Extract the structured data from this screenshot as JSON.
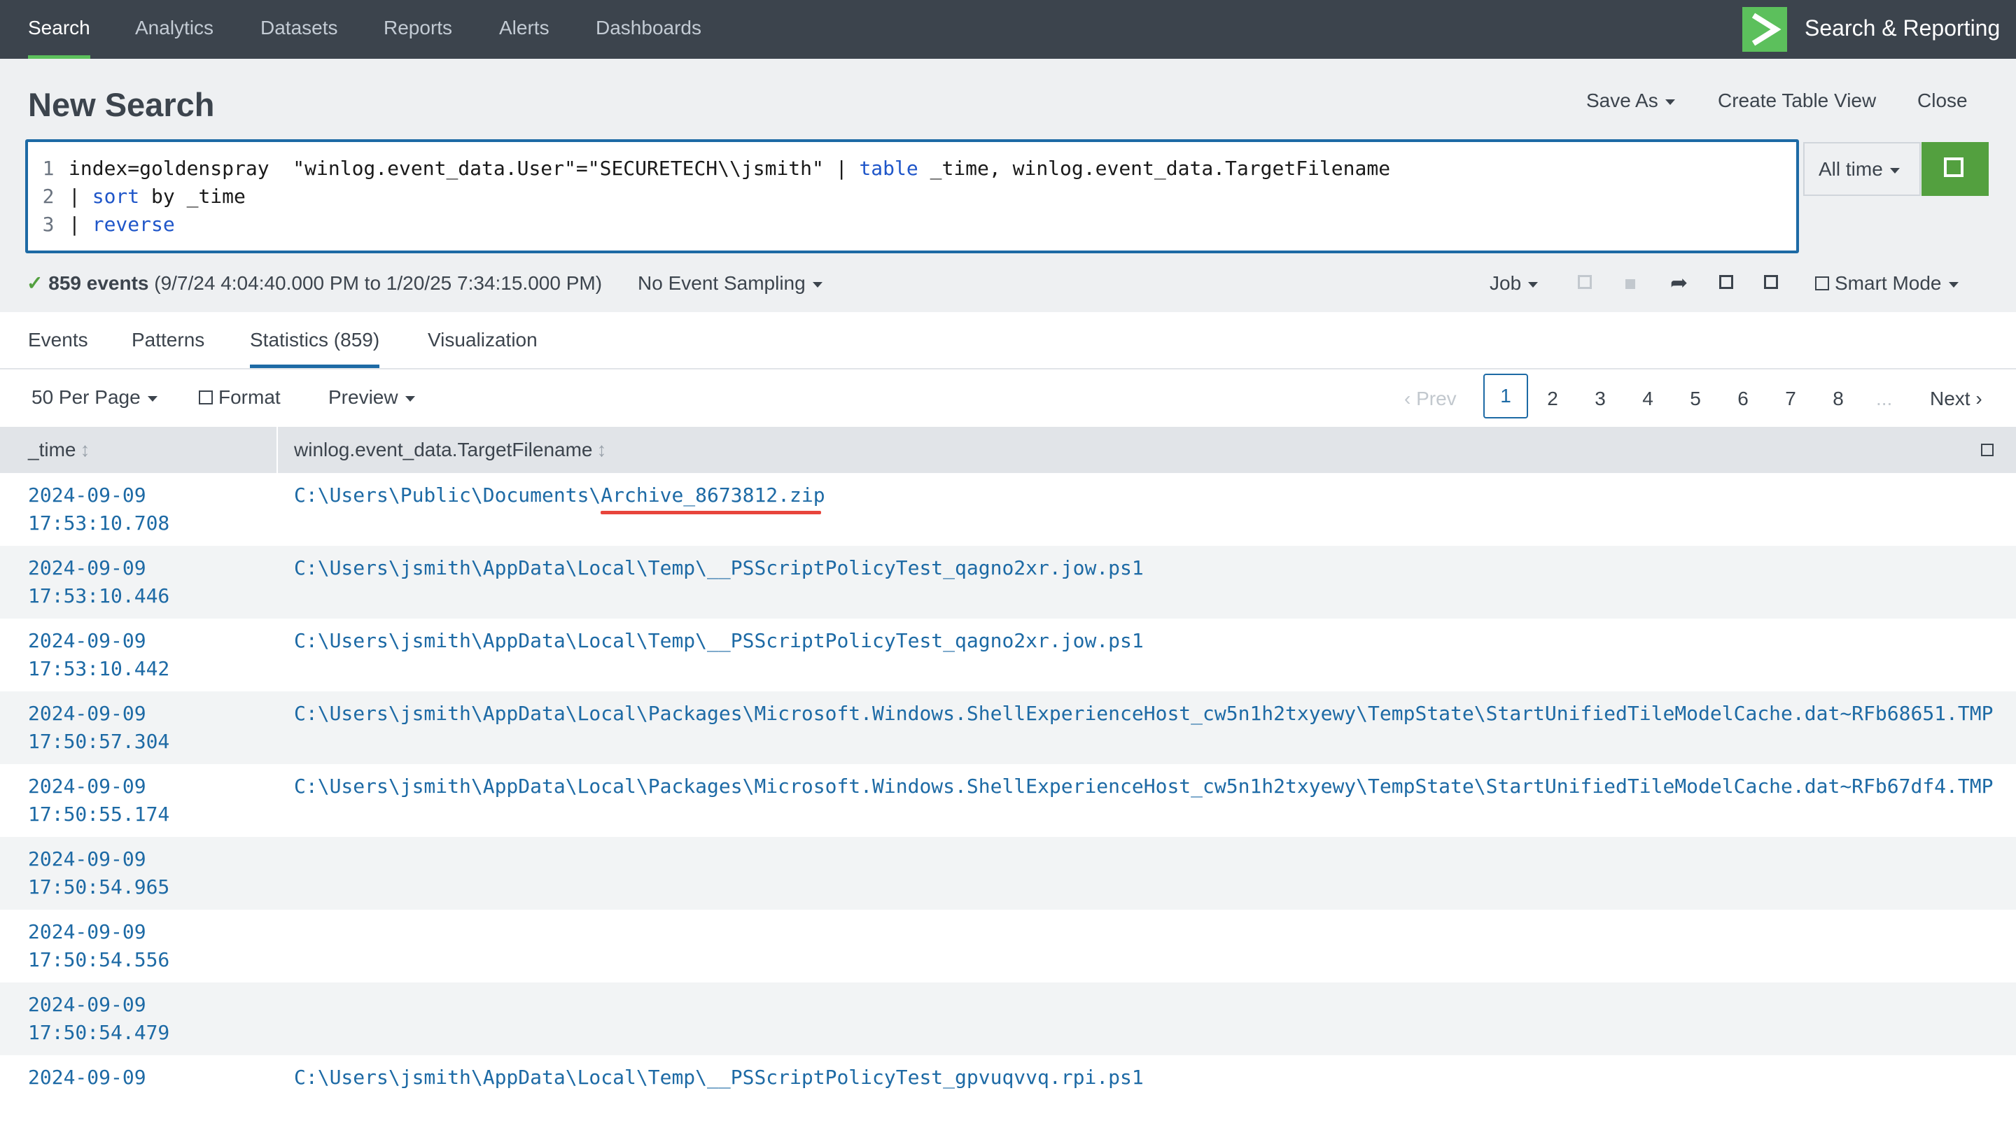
{
  "nav": {
    "items": [
      "Search",
      "Analytics",
      "Datasets",
      "Reports",
      "Alerts",
      "Dashboards"
    ],
    "app_name": "Search & Reporting"
  },
  "header": {
    "title": "New Search",
    "save_as": "Save As",
    "create_table_view": "Create Table View",
    "close": "Close"
  },
  "query": {
    "line_numbers": [
      "1",
      "2",
      "3"
    ],
    "line1_a": "index=goldenspray  \"winlog.event_data.User\"=\"SECURETECH\\\\jsmith\" | ",
    "line1_kw": "table",
    "line1_b": " _time, winlog.event_data.TargetFilename",
    "line2_a": "| ",
    "line2_kw": "sort",
    "line2_b": " by _time",
    "line3_a": "| ",
    "line3_kw": "reverse"
  },
  "time_picker": {
    "label": "All time"
  },
  "status": {
    "events": "859 events",
    "range": " (9/7/24 4:04:40.000 PM to 1/20/25 7:34:15.000 PM)",
    "sampling": "No Event Sampling",
    "job": "Job",
    "mode": "Smart Mode"
  },
  "tabs": [
    "Events",
    "Patterns",
    "Statistics (859)",
    "Visualization"
  ],
  "toolbar": {
    "per_page": "50 Per Page",
    "format": "Format",
    "preview": "Preview"
  },
  "pagination": {
    "prev": "‹ Prev",
    "pages": [
      "1",
      "2",
      "3",
      "4",
      "5",
      "6",
      "7",
      "8"
    ],
    "ellipsis": "...",
    "next": "Next ›"
  },
  "table": {
    "headers": [
      "_time",
      "winlog.event_data.TargetFilename"
    ],
    "rows": [
      {
        "date": "2024-09-09",
        "time": "17:53:10.708",
        "file_prefix": "C:\\Users\\Public\\Documents\\",
        "file_name": "Archive_8673812.zip"
      },
      {
        "date": "2024-09-09",
        "time": "17:53:10.446",
        "file_prefix": "C:\\Users\\jsmith\\AppData\\Local\\Temp\\__PSScriptPolicyTest_qagno2xr.jow.ps1",
        "file_name": ""
      },
      {
        "date": "2024-09-09",
        "time": "17:53:10.442",
        "file_prefix": "C:\\Users\\jsmith\\AppData\\Local\\Temp\\__PSScriptPolicyTest_qagno2xr.jow.ps1",
        "file_name": ""
      },
      {
        "date": "2024-09-09",
        "time": "17:50:57.304",
        "file_prefix": "C:\\Users\\jsmith\\AppData\\Local\\Packages\\Microsoft.Windows.ShellExperienceHost_cw5n1h2txyewy\\TempState\\StartUnifiedTileModelCache.dat~RFb68651.TMP",
        "file_name": ""
      },
      {
        "date": "2024-09-09",
        "time": "17:50:55.174",
        "file_prefix": "C:\\Users\\jsmith\\AppData\\Local\\Packages\\Microsoft.Windows.ShellExperienceHost_cw5n1h2txyewy\\TempState\\StartUnifiedTileModelCache.dat~RFb67df4.TMP",
        "file_name": ""
      },
      {
        "date": "2024-09-09",
        "time": "17:50:54.965",
        "file_prefix": "",
        "file_name": ""
      },
      {
        "date": "2024-09-09",
        "time": "17:50:54.556",
        "file_prefix": "",
        "file_name": ""
      },
      {
        "date": "2024-09-09",
        "time": "17:50:54.479",
        "file_prefix": "",
        "file_name": ""
      },
      {
        "date": "2024-09-09",
        "time": "",
        "file_prefix": "C:\\Users\\jsmith\\AppData\\Local\\Temp\\__PSScriptPolicyTest_gpvuqvvq.rpi.ps1",
        "file_name": ""
      }
    ]
  },
  "colors": {
    "nav_bg": "#3c444d",
    "accent_green": "#5cc05c",
    "link_blue": "#1d6aa5",
    "highlight_red": "#e8453c"
  }
}
